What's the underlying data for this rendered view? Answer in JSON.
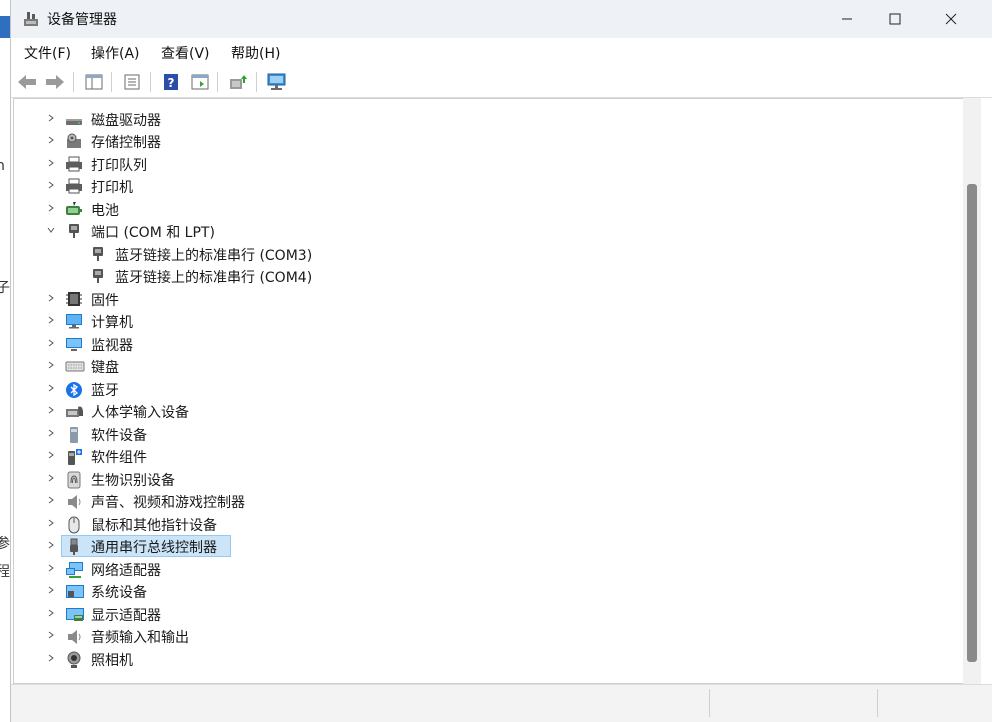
{
  "window": {
    "title": "设备管理器",
    "app_icon": "device-manager-icon",
    "controls": [
      "minimize-icon",
      "maximize-icon",
      "close-icon"
    ]
  },
  "menu": {
    "items": [
      {
        "label": "文件(F)"
      },
      {
        "label": "操作(A)"
      },
      {
        "label": "查看(V)"
      },
      {
        "label": "帮助(H)"
      }
    ]
  },
  "toolbar": {
    "buttons": [
      "back-arrow-icon",
      "forward-arrow-icon",
      "show-hide-tree-icon",
      "properties-icon",
      "help-icon",
      "run-icon",
      "update-driver-icon",
      "scan-hardware-icon"
    ]
  },
  "tree": {
    "items": [
      {
        "label": "磁盘驱动器",
        "icon": "disk-drive-icon",
        "expanded": false,
        "level": 1
      },
      {
        "label": "存储控制器",
        "icon": "storage-controller-icon",
        "expanded": false,
        "level": 1
      },
      {
        "label": "打印队列",
        "icon": "print-queue-icon",
        "expanded": false,
        "level": 1
      },
      {
        "label": "打印机",
        "icon": "printer-icon",
        "expanded": false,
        "level": 1
      },
      {
        "label": "电池",
        "icon": "battery-icon",
        "expanded": false,
        "level": 1
      },
      {
        "label": "端口 (COM 和 LPT)",
        "icon": "port-icon",
        "expanded": true,
        "level": 1
      },
      {
        "label": "蓝牙链接上的标准串行 (COM3)",
        "icon": "port-icon",
        "level": 2
      },
      {
        "label": "蓝牙链接上的标准串行 (COM4)",
        "icon": "port-icon",
        "level": 2
      },
      {
        "label": "固件",
        "icon": "firmware-icon",
        "expanded": false,
        "level": 1
      },
      {
        "label": "计算机",
        "icon": "computer-icon",
        "expanded": false,
        "level": 1
      },
      {
        "label": "监视器",
        "icon": "monitor-icon",
        "expanded": false,
        "level": 1
      },
      {
        "label": "键盘",
        "icon": "keyboard-icon",
        "expanded": false,
        "level": 1
      },
      {
        "label": "蓝牙",
        "icon": "bluetooth-icon",
        "expanded": false,
        "level": 1
      },
      {
        "label": "人体学输入设备",
        "icon": "hid-icon",
        "expanded": false,
        "level": 1
      },
      {
        "label": "软件设备",
        "icon": "software-device-icon",
        "expanded": false,
        "level": 1
      },
      {
        "label": "软件组件",
        "icon": "software-component-icon",
        "expanded": false,
        "level": 1
      },
      {
        "label": "生物识别设备",
        "icon": "biometric-icon",
        "expanded": false,
        "level": 1
      },
      {
        "label": "声音、视频和游戏控制器",
        "icon": "speaker-icon",
        "expanded": false,
        "level": 1
      },
      {
        "label": "鼠标和其他指针设备",
        "icon": "mouse-icon",
        "expanded": false,
        "level": 1
      },
      {
        "label": "通用串行总线控制器",
        "icon": "usb-icon",
        "expanded": false,
        "level": 1,
        "selected": true
      },
      {
        "label": "网络适配器",
        "icon": "network-adapter-icon",
        "expanded": false,
        "level": 1
      },
      {
        "label": "系统设备",
        "icon": "system-device-icon",
        "expanded": false,
        "level": 1
      },
      {
        "label": "显示适配器",
        "icon": "display-adapter-icon",
        "expanded": false,
        "level": 1
      },
      {
        "label": "音频输入和输出",
        "icon": "audio-io-icon",
        "expanded": false,
        "level": 1
      },
      {
        "label": "照相机",
        "icon": "camera-icon",
        "expanded": false,
        "level": 1
      }
    ]
  },
  "background_fragments": [
    {
      "text": "n"
    },
    {
      "text": "子"
    },
    {
      "text": "参"
    },
    {
      "text": "程"
    }
  ],
  "colors": {
    "selection_bg": "#cce4f7",
    "selection_border": "#99c9ef",
    "titlebar_bg": "#eef2f7",
    "scroll_thumb": "#8a8a8a"
  }
}
